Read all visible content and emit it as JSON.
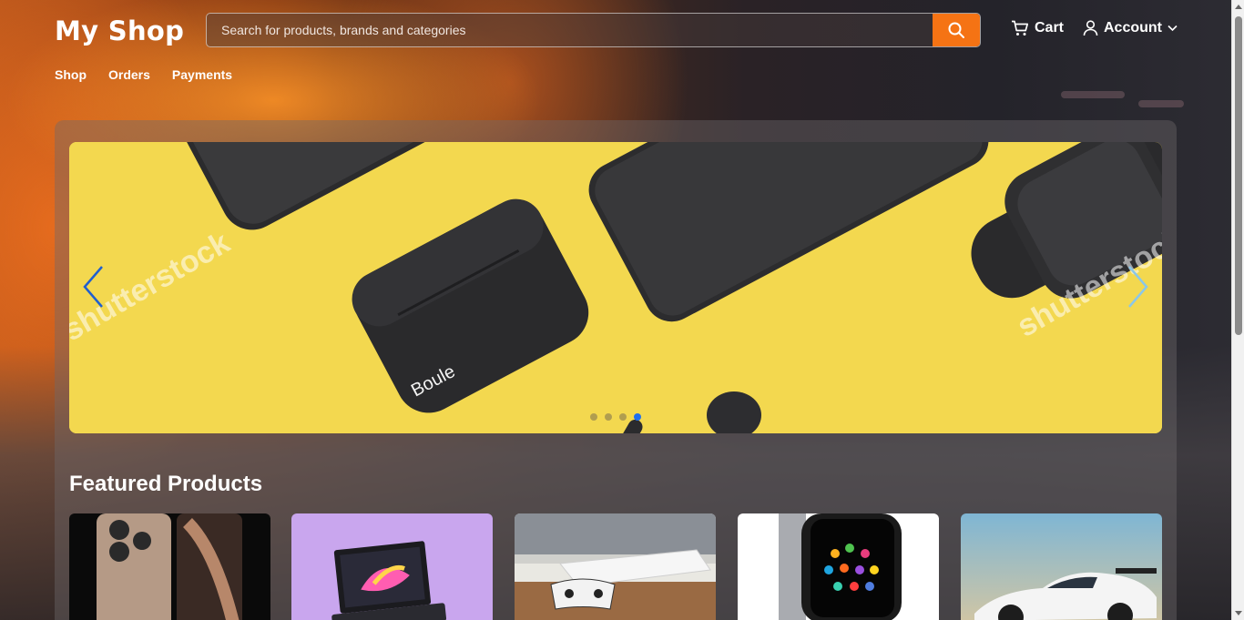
{
  "header": {
    "logo": "My Shop",
    "search": {
      "placeholder": "Search for products, brands and categories"
    },
    "cart_label": "Cart",
    "account_label": "Account"
  },
  "nav": {
    "items": [
      "Shop",
      "Orders",
      "Payments"
    ]
  },
  "carousel": {
    "slide_count": 4,
    "active_slide": 4,
    "watermark": "shutterstock",
    "brand_text": "Boule"
  },
  "featured": {
    "title": "Featured Products",
    "products": [
      {
        "image": "smartphone"
      },
      {
        "image": "laptop"
      },
      {
        "image": "game-console"
      },
      {
        "image": "smartwatch"
      },
      {
        "image": "sports-car"
      }
    ]
  },
  "colors": {
    "accent": "#f57314",
    "active_dot": "#1e6ff0",
    "banner_bg": "#f2d852"
  }
}
